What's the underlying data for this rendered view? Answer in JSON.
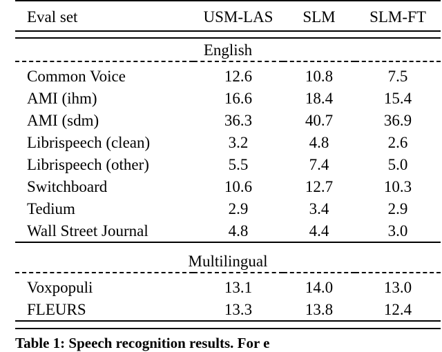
{
  "table": {
    "columns": [
      "Eval set",
      "USM-LAS",
      "SLM",
      "SLM-FT"
    ],
    "sections": [
      {
        "name": "English",
        "rows": [
          {
            "label": "Common Voice",
            "usm_las": "12.6",
            "slm": "10.8",
            "slm_ft": "7.5"
          },
          {
            "label": "AMI (ihm)",
            "usm_las": "16.6",
            "slm": "18.4",
            "slm_ft": "15.4"
          },
          {
            "label": "AMI (sdm)",
            "usm_las": "36.3",
            "slm": "40.7",
            "slm_ft": "36.9"
          },
          {
            "label": "Librispeech (clean)",
            "usm_las": "3.2",
            "slm": "4.8",
            "slm_ft": "2.6"
          },
          {
            "label": "Librispeech (other)",
            "usm_las": "5.5",
            "slm": "7.4",
            "slm_ft": "5.0"
          },
          {
            "label": "Switchboard",
            "usm_las": "10.6",
            "slm": "12.7",
            "slm_ft": "10.3"
          },
          {
            "label": "Tedium",
            "usm_las": "2.9",
            "slm": "3.4",
            "slm_ft": "2.9"
          },
          {
            "label": "Wall Street Journal",
            "usm_las": "4.8",
            "slm": "4.4",
            "slm_ft": "3.0"
          }
        ]
      },
      {
        "name": "Multilingual",
        "rows": [
          {
            "label": "Voxpopuli",
            "usm_las": "13.1",
            "slm": "14.0",
            "slm_ft": "13.0"
          },
          {
            "label": "FLEURS",
            "usm_las": "13.3",
            "slm": "13.8",
            "slm_ft": "12.4"
          }
        ]
      }
    ]
  },
  "caption": {
    "label": "Table 1:",
    "text": "Speech recognition results. For e"
  },
  "chart_data": {
    "type": "table",
    "title": "Speech recognition results",
    "columns": [
      "Eval set",
      "USM-LAS",
      "SLM",
      "SLM-FT"
    ],
    "groups": [
      {
        "group": "English",
        "rows": [
          [
            "Common Voice",
            12.6,
            10.8,
            7.5
          ],
          [
            "AMI (ihm)",
            16.6,
            18.4,
            15.4
          ],
          [
            "AMI (sdm)",
            36.3,
            40.7,
            36.9
          ],
          [
            "Librispeech (clean)",
            3.2,
            4.8,
            2.6
          ],
          [
            "Librispeech (other)",
            5.5,
            7.4,
            5.0
          ],
          [
            "Switchboard",
            10.6,
            12.7,
            10.3
          ],
          [
            "Tedium",
            2.9,
            3.4,
            2.9
          ],
          [
            "Wall Street Journal",
            4.8,
            4.4,
            3.0
          ]
        ]
      },
      {
        "group": "Multilingual",
        "rows": [
          [
            "Voxpopuli",
            13.1,
            14.0,
            13.0
          ],
          [
            "FLEURS",
            13.3,
            13.8,
            12.4
          ]
        ]
      }
    ]
  }
}
